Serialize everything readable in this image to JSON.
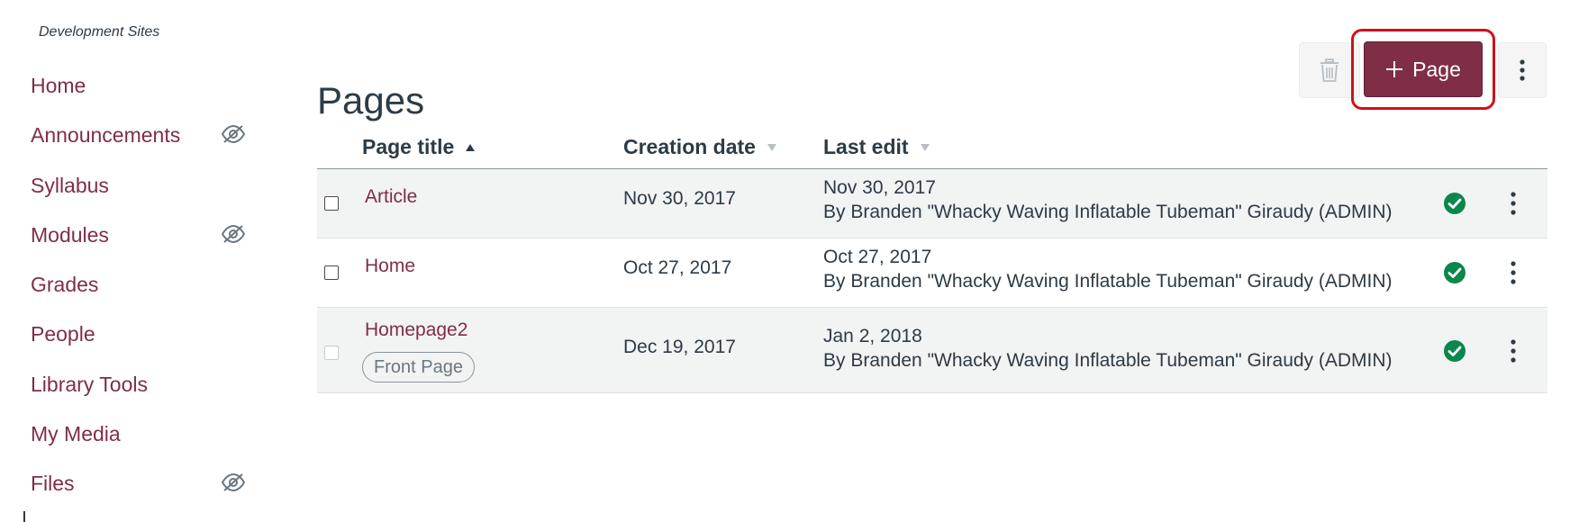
{
  "course": {
    "label": "Development Sites"
  },
  "nav": {
    "items": [
      {
        "label": "Home",
        "hidden": false
      },
      {
        "label": "Announcements",
        "hidden": true
      },
      {
        "label": "Syllabus",
        "hidden": false
      },
      {
        "label": "Modules",
        "hidden": true
      },
      {
        "label": "Grades",
        "hidden": false
      },
      {
        "label": "People",
        "hidden": false
      },
      {
        "label": "Library Tools",
        "hidden": false
      },
      {
        "label": "My Media",
        "hidden": false
      },
      {
        "label": "Files",
        "hidden": true
      }
    ]
  },
  "header": {
    "title": "Pages",
    "add_page_label": "Page"
  },
  "table": {
    "columns": {
      "title": "Page title",
      "created": "Creation date",
      "edited": "Last edit"
    },
    "rows": [
      {
        "title": "Article",
        "created": "Nov 30, 2017",
        "edit_date": "Nov 30, 2017",
        "edit_by": "By Branden \"Whacky Waving Inflatable Tubeman\" Giraudy (ADMIN)",
        "front_page": ""
      },
      {
        "title": "Home",
        "created": "Oct 27, 2017",
        "edit_date": "Oct 27, 2017",
        "edit_by": "By Branden \"Whacky Waving Inflatable Tubeman\" Giraudy (ADMIN)",
        "front_page": ""
      },
      {
        "title": "Homepage2",
        "created": "Dec 19, 2017",
        "edit_date": "Jan 2, 2018",
        "edit_by": "By Branden \"Whacky Waving Inflatable Tubeman\" Giraudy (ADMIN)",
        "front_page": "Front Page"
      }
    ]
  },
  "colors": {
    "brand": "#7f2e46",
    "published": "#0b874b",
    "highlight": "#d0101b"
  },
  "icons": {
    "hidden": "eye-slash-icon",
    "delete": "trash-icon",
    "add": "plus-icon",
    "more": "kebab-icon",
    "published": "check-circle-icon"
  }
}
